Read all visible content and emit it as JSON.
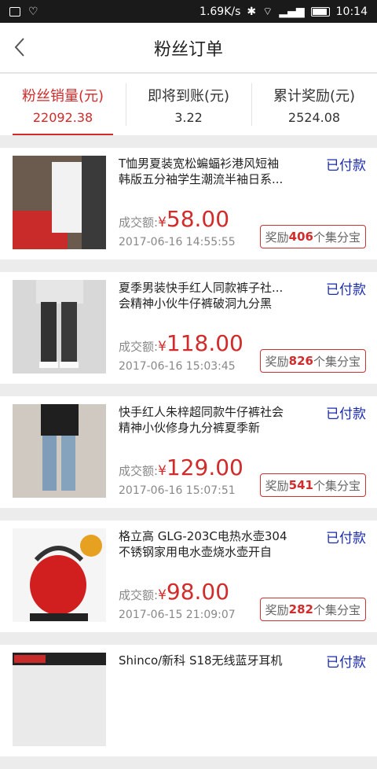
{
  "status_bar": {
    "speed": "1.69K/s",
    "time": "10:14"
  },
  "header": {
    "title": "粉丝订单"
  },
  "tabs": [
    {
      "label": "粉丝销量(元)",
      "value": "22092.38"
    },
    {
      "label": "即将到账(元)",
      "value": "3.22"
    },
    {
      "label": "累计奖励(元)",
      "value": "2524.08"
    }
  ],
  "orders": [
    {
      "name": "T恤男夏装宽松蝙蝠衫港风短袖韩版五分袖学生潮流半袖日系...",
      "status": "已付款",
      "price_label": "成交额:",
      "currency": "¥",
      "price": "58.00",
      "date": "2017-06-16 14:55:55",
      "reward_prefix": "奖励",
      "reward_count": "406",
      "reward_suffix": "个集分宝"
    },
    {
      "name": "夏季男装快手红人同款裤子社...会精神小伙牛仔裤破洞九分黑",
      "status": "已付款",
      "price_label": "成交额:",
      "currency": "¥",
      "price": "118.00",
      "date": "2017-06-16 15:03:45",
      "reward_prefix": "奖励",
      "reward_count": "826",
      "reward_suffix": "个集分宝"
    },
    {
      "name": "快手红人朱梓超同款牛仔裤社会精神小伙修身九分裤夏季新",
      "status": "已付款",
      "price_label": "成交额:",
      "currency": "¥",
      "price": "129.00",
      "date": "2017-06-16 15:07:51",
      "reward_prefix": "奖励",
      "reward_count": "541",
      "reward_suffix": "个集分宝"
    },
    {
      "name": "格立高 GLG-203C电热水壶304不锈钢家用电水壶烧水壶开自",
      "status": "已付款",
      "price_label": "成交额:",
      "currency": "¥",
      "price": "98.00",
      "date": "2017-06-15 21:09:07",
      "reward_prefix": "奖励",
      "reward_count": "282",
      "reward_suffix": "个集分宝"
    },
    {
      "name": "Shinco/新科 S18无线蓝牙耳机",
      "status": "已付款",
      "price_label": "",
      "currency": "",
      "price": "",
      "date": "",
      "reward_prefix": "",
      "reward_count": "",
      "reward_suffix": ""
    }
  ]
}
